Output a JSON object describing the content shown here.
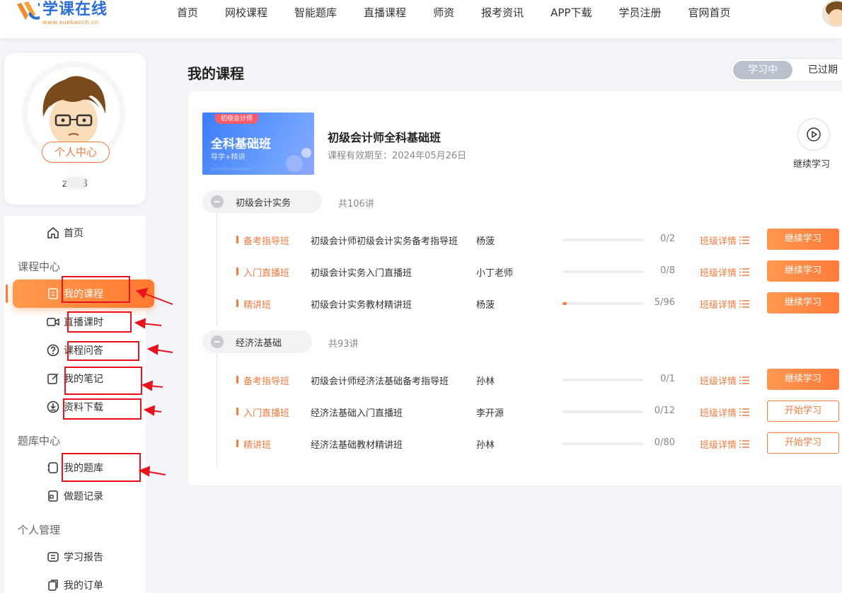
{
  "brand": {
    "name": "学课在线",
    "domain": "www.xuekaoch.cn",
    "colors": {
      "primary": "#2b6fd6",
      "accent": "#f07b3f",
      "annotation": "#e8131c"
    }
  },
  "nav": {
    "items": [
      {
        "label": "首页"
      },
      {
        "label": "网校课程"
      },
      {
        "label": "智能题库"
      },
      {
        "label": "直播课程"
      },
      {
        "label": "师资"
      },
      {
        "label": "报考资讯"
      },
      {
        "label": "APP下载"
      },
      {
        "label": "学员注册"
      },
      {
        "label": "官网首页"
      }
    ]
  },
  "profile": {
    "center_label": "个人中心",
    "username": "ze68"
  },
  "sidebar": {
    "home": {
      "label": "首页",
      "icon": "home-icon"
    },
    "groups": {
      "course": "课程中心",
      "question": "题库中心",
      "personal": "个人管理"
    },
    "items": {
      "my_courses": {
        "label": "我的课程",
        "icon": "course-icon"
      },
      "live_hours": {
        "label": "直播课时",
        "icon": "video-icon"
      },
      "course_qa": {
        "label": "课程问答",
        "icon": "question-icon"
      },
      "my_notes": {
        "label": "我的笔记",
        "icon": "note-icon"
      },
      "downloads": {
        "label": "资料下载",
        "icon": "download-icon"
      },
      "my_questions": {
        "label": "我的题库",
        "icon": "question-bank-icon"
      },
      "practice_records": {
        "label": "做题记录",
        "icon": "record-icon"
      },
      "study_report": {
        "label": "学习报告",
        "icon": "report-icon"
      },
      "my_orders": {
        "label": "我的订单",
        "icon": "order-icon"
      }
    }
  },
  "main": {
    "title": "我的课程",
    "tabs": {
      "active": "学习中",
      "inactive": "已过期"
    },
    "course": {
      "cover": {
        "tag": "初级会计师",
        "title": "全科基础班",
        "subtitle": "导学+精讲",
        "dots": "›››››››››››››››"
      },
      "title": "初级会计师全科基础班",
      "validity": "课程有效期至：2024年05月26日",
      "continue_label": "继续学习"
    },
    "subjects": [
      {
        "name": "初级会计实务",
        "count": "共106讲",
        "rows": [
          {
            "type": "备考指导班",
            "name": "初级会计师初级会计实务备考指导班",
            "teacher": "杨菠",
            "progress": 0,
            "count": "0/2",
            "detail": "班级详情",
            "action": "继续学习",
            "style": "fill"
          },
          {
            "type": "入门直播班",
            "name": "初级会计实务入门直播班",
            "teacher": "小丁老师",
            "progress": 0,
            "count": "0/8",
            "detail": "班级详情",
            "action": "继续学习",
            "style": "fill"
          },
          {
            "type": "精讲班",
            "name": "初级会计实务教材精讲班",
            "teacher": "杨菠",
            "progress": 0.052,
            "count": "5/96",
            "detail": "班级详情",
            "action": "继续学习",
            "style": "fill"
          }
        ]
      },
      {
        "name": "经济法基础",
        "count": "共93讲",
        "rows": [
          {
            "type": "备考指导班",
            "name": "初级会计师经济法基础备考指导班",
            "teacher": "孙林",
            "progress": 0,
            "count": "0/1",
            "detail": "班级详情",
            "action": "继续学习",
            "style": "fill"
          },
          {
            "type": "入门直播班",
            "name": "经济法基础入门直播班",
            "teacher": "李开源",
            "progress": 0,
            "count": "0/12",
            "detail": "班级详情",
            "action": "开始学习",
            "style": "line"
          },
          {
            "type": "精讲班",
            "name": "经济法基础教材精讲班",
            "teacher": "孙林",
            "progress": 0,
            "count": "0/80",
            "detail": "班级详情",
            "action": "开始学习",
            "style": "line"
          }
        ]
      }
    ]
  }
}
